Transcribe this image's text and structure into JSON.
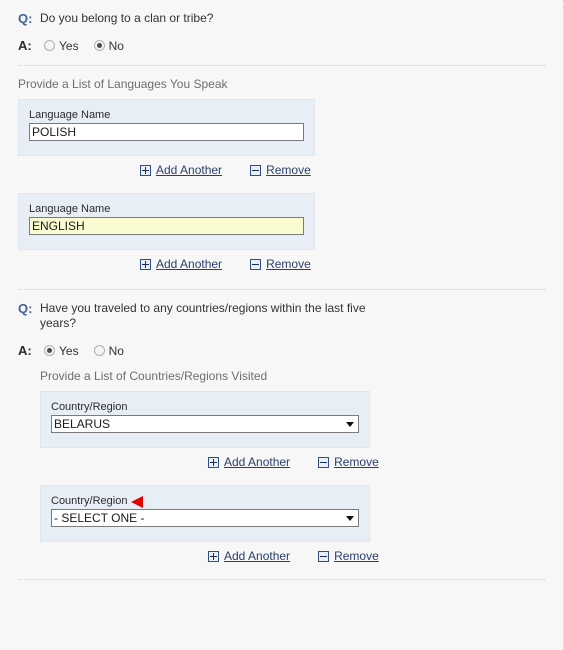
{
  "questions": [
    {
      "marker": "Q:",
      "text": "Do you belong to a clan or tribe?",
      "answer_marker": "A:",
      "options": [
        {
          "label": "Yes",
          "selected": false
        },
        {
          "label": "No",
          "selected": true
        }
      ]
    },
    {
      "marker": "Q:",
      "text": "Have you traveled to any countries/regions within the last five years?",
      "answer_marker": "A:",
      "options": [
        {
          "label": "Yes",
          "selected": true
        },
        {
          "label": "No",
          "selected": false
        }
      ]
    }
  ],
  "languages_section": {
    "heading": "Provide a List of Languages You Speak",
    "entries": [
      {
        "field_label": "Language Name",
        "value": "POLISH",
        "focused": false,
        "add_label": "Add Another",
        "remove_label": "Remove"
      },
      {
        "field_label": "Language Name",
        "value": "ENGLISH",
        "focused": true,
        "add_label": "Add Another",
        "remove_label": "Remove"
      }
    ]
  },
  "countries_section": {
    "heading": "Provide a List of Countries/Regions Visited",
    "entries": [
      {
        "field_label": "Country/Region",
        "value": "BELARUS",
        "has_cursor": false,
        "add_label": "Add Another",
        "remove_label": "Remove"
      },
      {
        "field_label": "Country/Region",
        "value": "- SELECT ONE -",
        "has_cursor": true,
        "add_label": "Add Another",
        "remove_label": "Remove"
      }
    ]
  },
  "colors": {
    "panel_background": "#e8eef6",
    "focus_highlight": "#fbfbd2",
    "link": "#2b3f69",
    "question_marker": "#41618f",
    "cursor_arrow": "#e00000"
  }
}
